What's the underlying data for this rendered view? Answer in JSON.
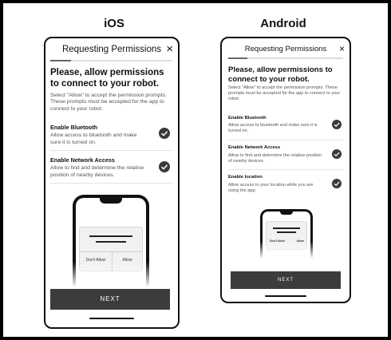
{
  "labels": {
    "ios": "iOS",
    "android": "Android"
  },
  "ios": {
    "header": "Requesting Permissions",
    "close": "×",
    "heading": "Please, allow permissions to connect to your robot.",
    "subtext": "Select \"Allow\" to accept the permission prompts. These prompts must be accepted for the app to connect to your robot.",
    "permissions": [
      {
        "title": "Enable Bluetooth",
        "desc": "Allow access to bluetooth and make sure it is turned on."
      },
      {
        "title": "Enable Network Access",
        "desc": "Allow to find and determine the relative position of nearby devices."
      }
    ],
    "dialog": {
      "deny": "Don't Allow",
      "allow": "Allow"
    },
    "next": "NEXT"
  },
  "android": {
    "header": "Requesting Permissions",
    "close": "×",
    "heading": "Please, allow permissions to connect to your robot.",
    "subtext": "Select \"Allow\" to accept the permission prompts. These prompts must be accepted for the app to connect to your robot.",
    "permissions": [
      {
        "title": "Enable Bluetooth",
        "desc": "Allow access to bluetooth and make sure it is turned on."
      },
      {
        "title": "Enable Network Access",
        "desc": "Allow to find and determine the relative position of nearby devices."
      },
      {
        "title": "Enable location",
        "desc": "Allow access to your location while you are using the app."
      }
    ],
    "dialog": {
      "deny": "Don't Allow",
      "allow": "Allow"
    },
    "next": "NEXT"
  },
  "colors": {
    "primary_button": "#3c3c3c",
    "check": "#3a3a3a"
  }
}
